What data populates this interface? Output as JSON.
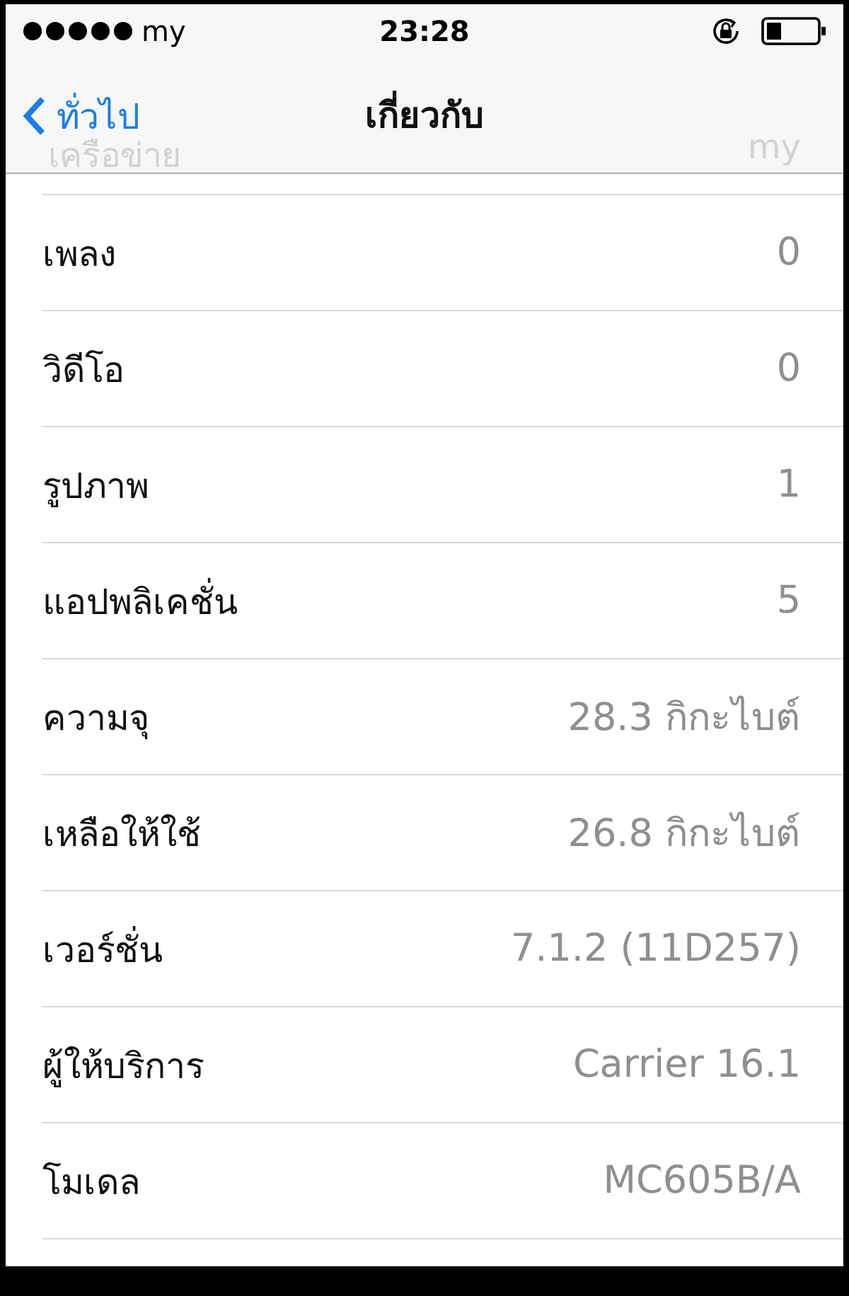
{
  "status_bar": {
    "carrier": "my",
    "time": "23:28"
  },
  "nav": {
    "back": "ทั่วไป",
    "title": "เกี่ยวกับ",
    "behind": {
      "label": "เครือข่าย",
      "value": "my"
    }
  },
  "rows": [
    {
      "label": "เพลง",
      "value": "0"
    },
    {
      "label": "วิดีโอ",
      "value": "0"
    },
    {
      "label": "รูปภาพ",
      "value": "1"
    },
    {
      "label": "แอปพลิเคชั่น",
      "value": "5"
    },
    {
      "label": "ความจุ",
      "value": "28.3 กิกะไบต์"
    },
    {
      "label": "เหลือให้ใช้",
      "value": "26.8 กิกะไบต์"
    },
    {
      "label": "เวอร์ชั่น",
      "value": "7.1.2 (11D257)"
    },
    {
      "label": "ผู้ให้บริการ",
      "value": "Carrier 16.1"
    },
    {
      "label": "โมเดล",
      "value": "MC605B/A"
    }
  ]
}
